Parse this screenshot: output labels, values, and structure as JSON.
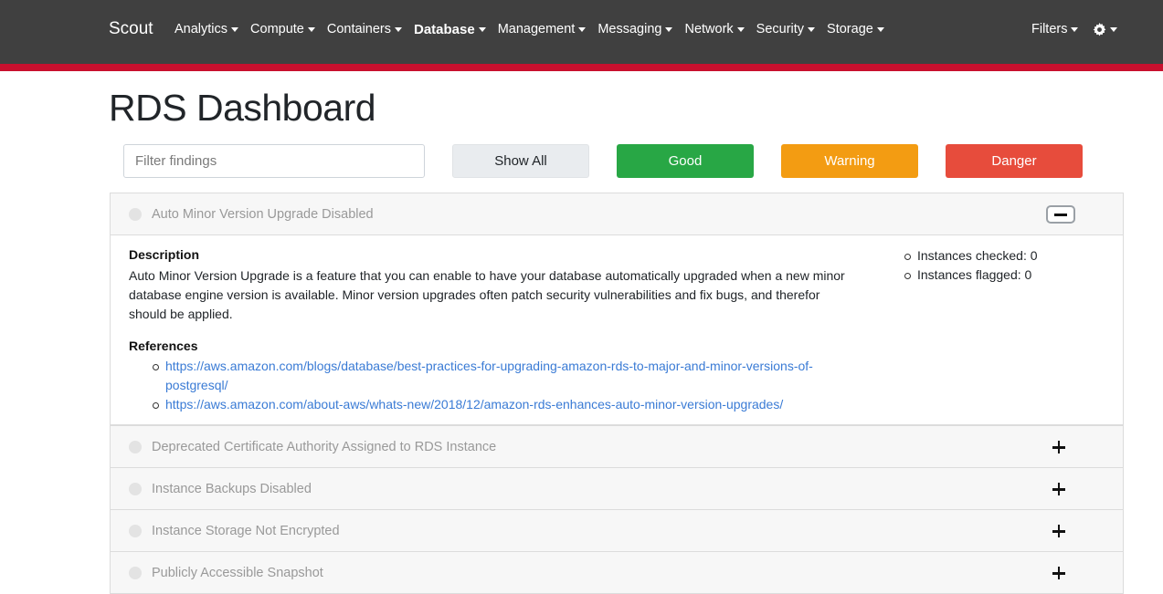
{
  "navbar": {
    "brand": "Scout",
    "items": [
      {
        "label": "Analytics"
      },
      {
        "label": "Compute"
      },
      {
        "label": "Containers"
      },
      {
        "label": "Database",
        "active": true
      },
      {
        "label": "Management"
      },
      {
        "label": "Messaging"
      },
      {
        "label": "Network"
      },
      {
        "label": "Security"
      },
      {
        "label": "Storage"
      }
    ],
    "filters_label": "Filters",
    "settings_icon": "gear-icon",
    "accent_color": "#c8102e"
  },
  "page": {
    "title": "RDS Dashboard"
  },
  "filter": {
    "placeholder": "Filter findings",
    "value": ""
  },
  "buttons": {
    "show_all": "Show All",
    "good": "Good",
    "warning": "Warning",
    "danger": "Danger"
  },
  "colors": {
    "good": "#28a745",
    "warning": "#f39c12",
    "danger": "#e74c3c"
  },
  "findings": [
    {
      "title": "Auto Minor Version Upgrade Disabled",
      "expanded": true,
      "description_heading": "Description",
      "description": "Auto Minor Version Upgrade is a feature that you can enable to have your database automatically upgraded when a new minor database engine version is available. Minor version upgrades often patch security vulnerabilities and fix bugs, and therefor should be applied.",
      "references_heading": "References",
      "references": [
        "https://aws.amazon.com/blogs/database/best-practices-for-upgrading-amazon-rds-to-major-and-minor-versions-of-postgresql/",
        "https://aws.amazon.com/about-aws/whats-new/2018/12/amazon-rds-enhances-auto-minor-version-upgrades/"
      ],
      "stats": [
        "Instances checked: 0",
        "Instances flagged: 0"
      ]
    },
    {
      "title": "Deprecated Certificate Authority Assigned to RDS Instance",
      "expanded": false
    },
    {
      "title": "Instance Backups Disabled",
      "expanded": false
    },
    {
      "title": "Instance Storage Not Encrypted",
      "expanded": false
    },
    {
      "title": "Publicly Accessible Snapshot",
      "expanded": false
    }
  ]
}
